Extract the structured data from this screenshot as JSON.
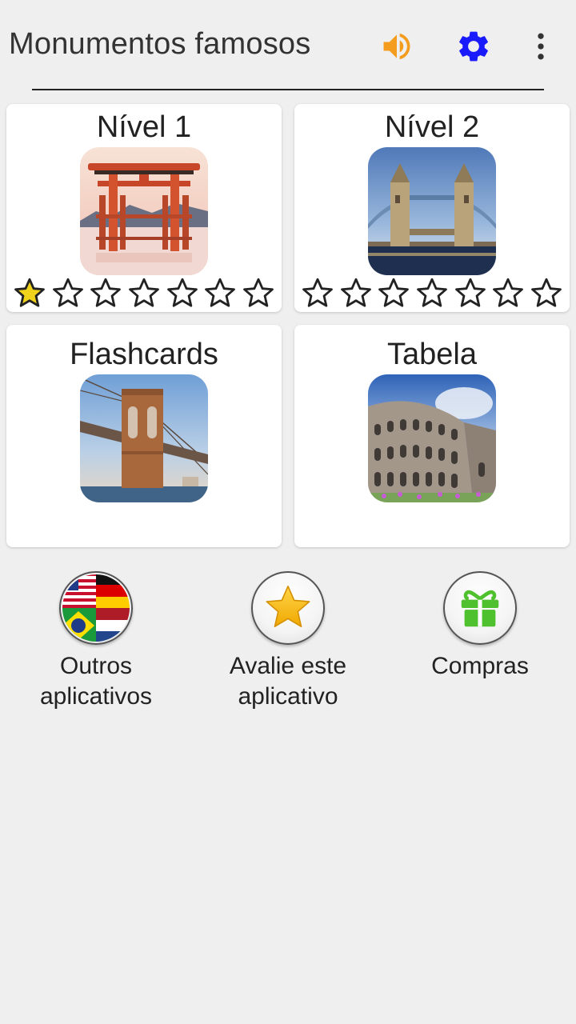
{
  "header": {
    "title": "Monumentos famosos",
    "icons": [
      "sound-icon",
      "gear-icon",
      "more-vert-icon"
    ],
    "colors": {
      "sound": "#f39c1e",
      "gear": "#1a1aff"
    }
  },
  "cards": [
    {
      "title": "Nível 1",
      "image": "torii-gate",
      "stars_filled": 1,
      "stars_total": 7
    },
    {
      "title": "Nível 2",
      "image": "tower-bridge",
      "stars_filled": 0,
      "stars_total": 7
    },
    {
      "title": "Flashcards",
      "image": "brooklyn-bridge"
    },
    {
      "title": "Tabela",
      "image": "colosseum"
    }
  ],
  "bottom": [
    {
      "label_line1": "Outros",
      "label_line2": "aplicativos",
      "icon": "flags-icon"
    },
    {
      "label_line1": "Avalie este",
      "label_line2": "aplicativo",
      "icon": "star-icon"
    },
    {
      "label_line1": "Compras",
      "label_line2": "",
      "icon": "gift-icon"
    }
  ]
}
